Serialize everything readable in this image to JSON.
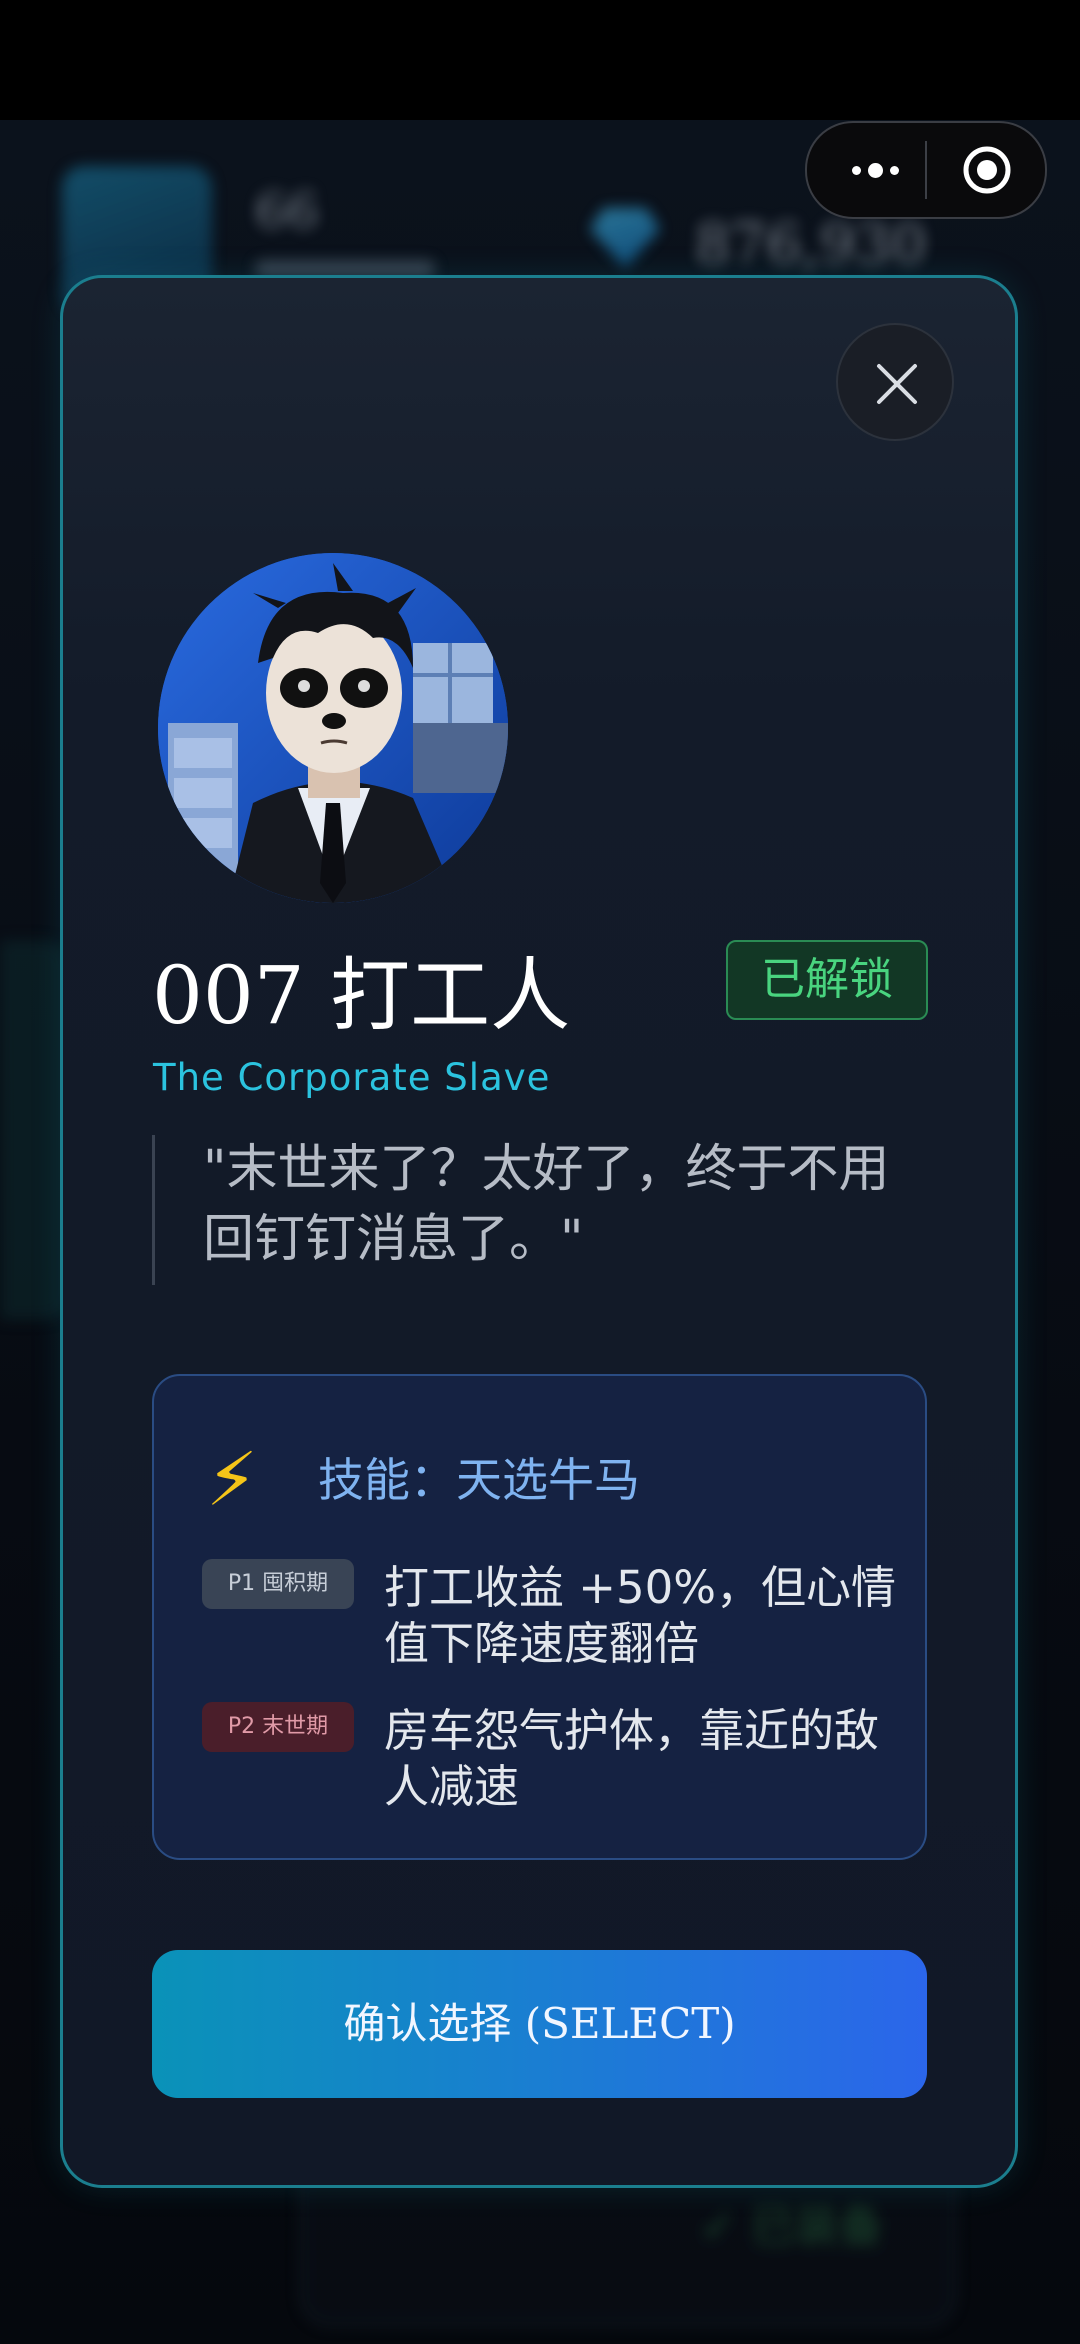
{
  "background": {
    "level": "66",
    "coins": "876,930",
    "equipped_label": "✓ 已装备"
  },
  "capsule": {
    "more_icon": "more-dots-icon",
    "target_icon": "target-circle-icon"
  },
  "modal": {
    "close_icon": "close-x-icon",
    "character": {
      "name": "007 打工人",
      "name_en": "The Corporate Slave",
      "status_badge": "已解锁",
      "quote": "\"末世来了？太好了，终于不用回钉钉消息了。\""
    },
    "skill": {
      "icon": "⚡",
      "title": "技能：天选牛马",
      "phases": [
        {
          "tag": "P1 囤积期",
          "description": "打工收益 +50%，但心情值下降速度翻倍"
        },
        {
          "tag": "P2 末世期",
          "description": "房车怨气护体，靠近的敌人减速"
        }
      ]
    },
    "select_button": "确认选择 (SELECT)"
  },
  "colors": {
    "accent_border": "#1b7e8e",
    "badge_green": "#49d47f",
    "english_name": "#2bc3df",
    "skill_title": "#7fb3f0",
    "button_start": "#0a92b8",
    "button_end": "#2b66ea"
  }
}
